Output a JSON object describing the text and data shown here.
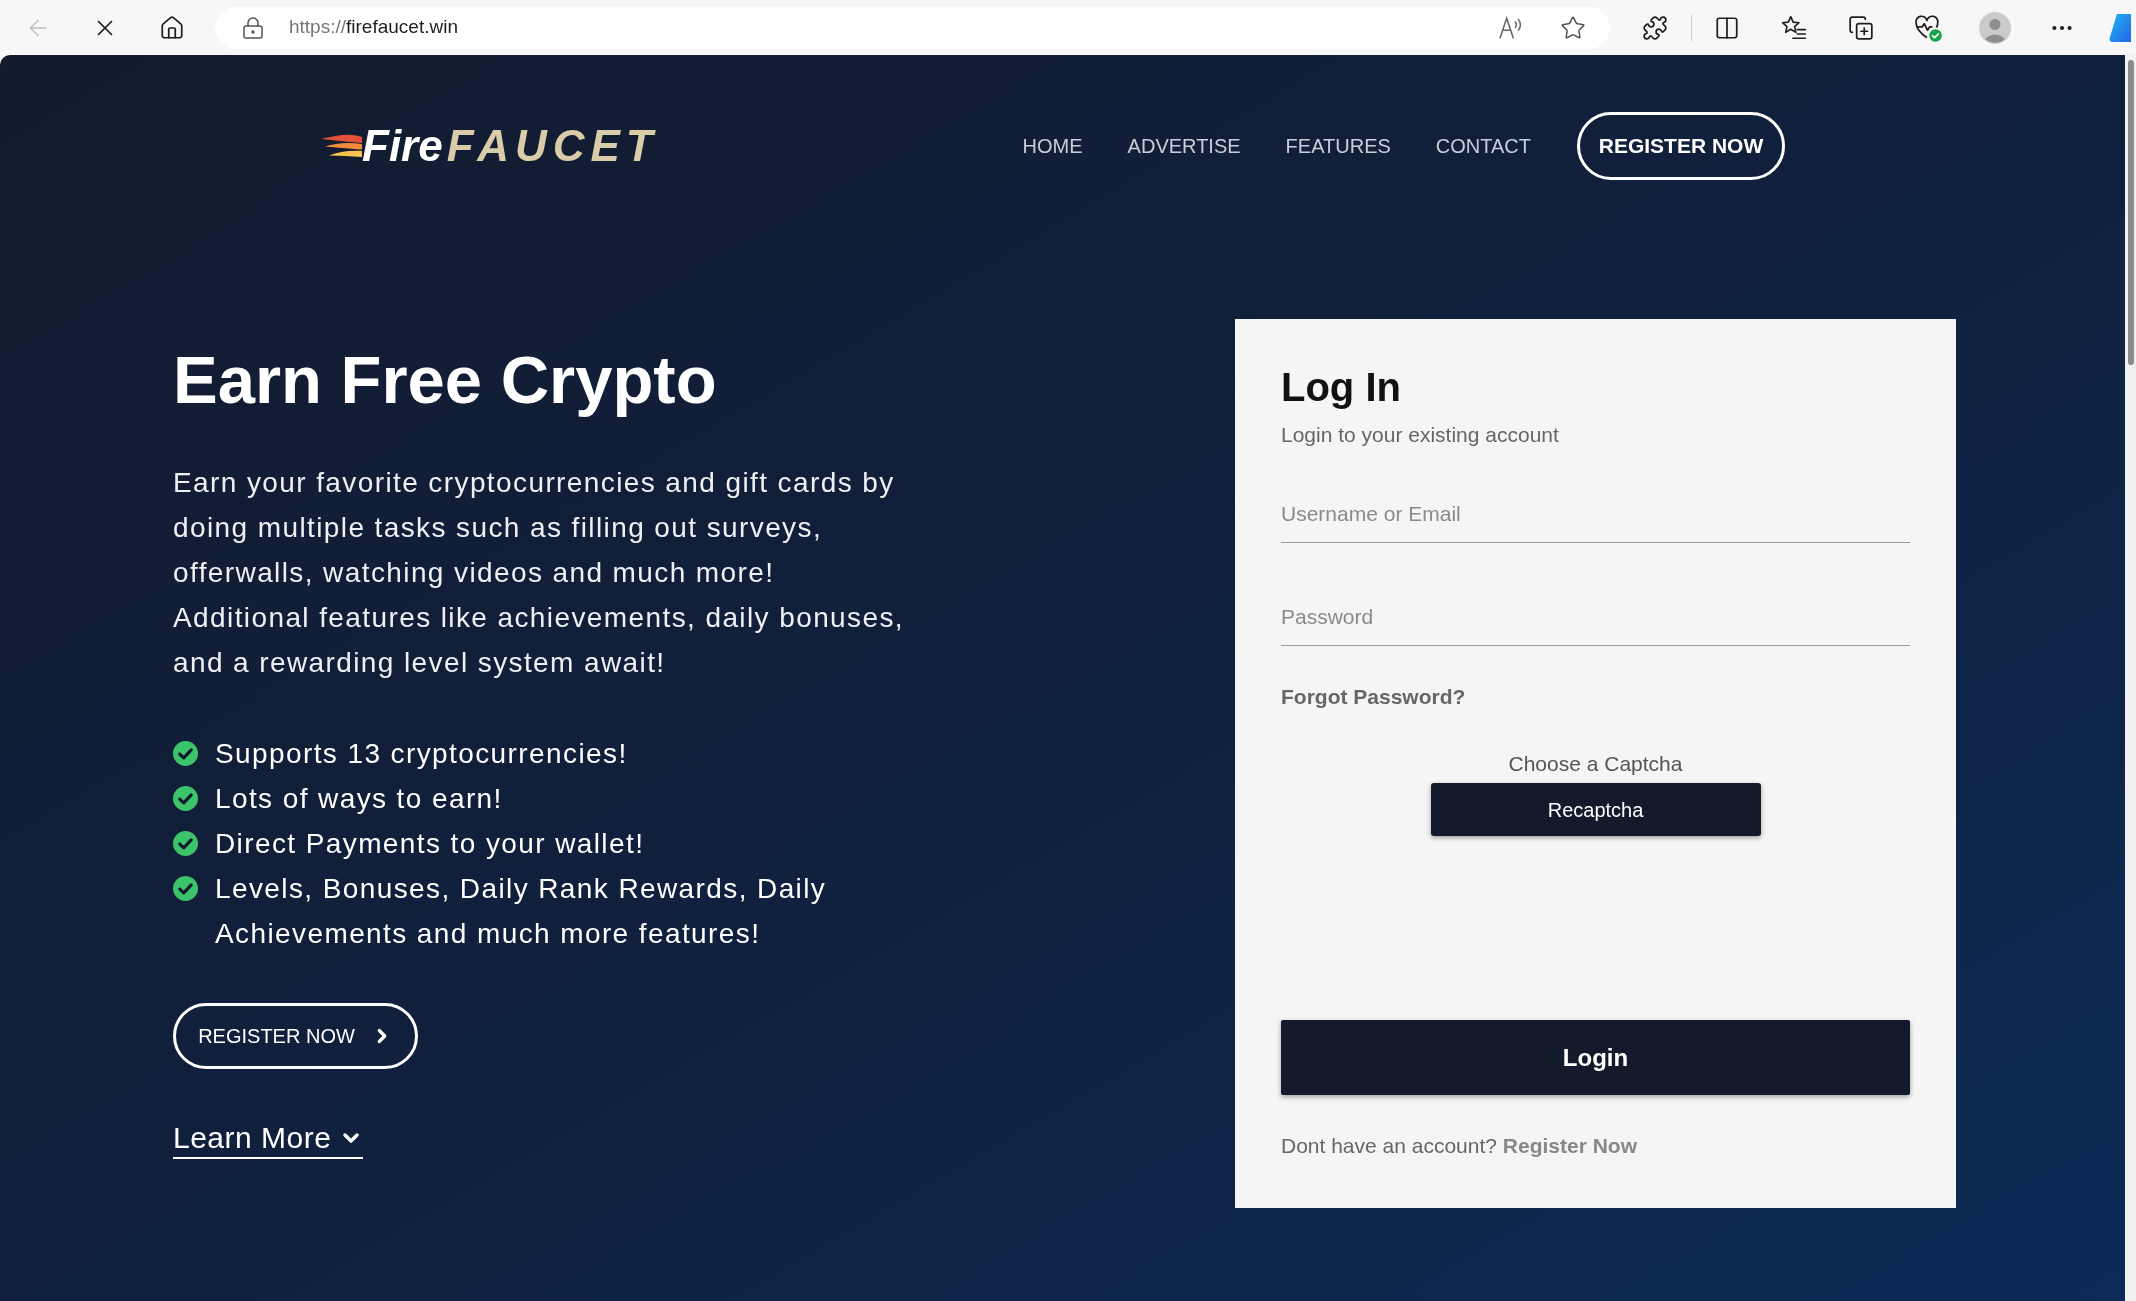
{
  "browser": {
    "back": {
      "disabled": true
    },
    "url": {
      "scheme": "https://",
      "host": "firefaucet.win"
    }
  },
  "header": {
    "logo": {
      "text_main": "Fire",
      "text_accent": "FAUCET"
    },
    "nav_links": [
      "HOME",
      "ADVERTISE",
      "FEATURES",
      "CONTACT"
    ],
    "register_button": "REGISTER NOW"
  },
  "hero": {
    "title": "Earn Free Crypto",
    "description": "Earn your favorite cryptocurrencies and gift cards by doing multiple tasks such as filling out surveys, offerwalls, watching videos and much more! Additional features like achievements, daily bonuses, and a rewarding level system await!",
    "features": [
      "Supports 13 cryptocurrencies!",
      "Lots of ways to earn!",
      "Direct Payments to your wallet!",
      "Levels, Bonuses, Daily Rank Rewards, Daily Achievements and much more features!"
    ],
    "register_button": "REGISTER NOW",
    "learn_more": "Learn More"
  },
  "login_card": {
    "title": "Log In",
    "subtitle": "Login to your existing account",
    "fields": [
      {
        "placeholder": "Username or Email"
      },
      {
        "placeholder": "Password"
      }
    ],
    "forgot_link": "Forgot Password?",
    "captcha": {
      "label": "Choose a Captcha",
      "button": "Recaptcha"
    },
    "login_button": "Login",
    "signup_prompt": {
      "text": "Dont have an account?",
      "link": "Register Now"
    }
  }
}
